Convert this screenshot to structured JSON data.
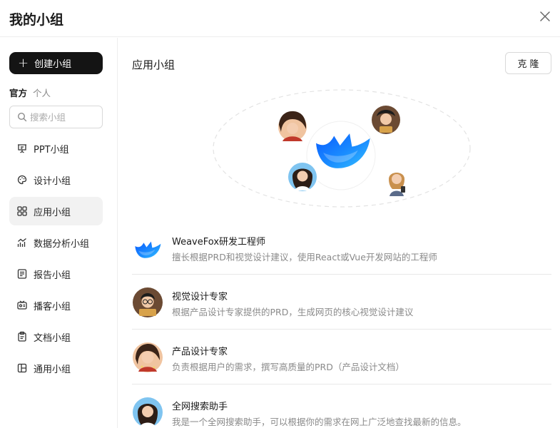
{
  "header": {
    "title": "我的小组"
  },
  "sidebar": {
    "create_label": "创建小组",
    "scope": {
      "official": "官方",
      "personal": "个人"
    },
    "search_placeholder": "搜索小组",
    "items": [
      {
        "label": "PPT小组",
        "icon": "presentation-icon"
      },
      {
        "label": "设计小组",
        "icon": "palette-icon"
      },
      {
        "label": "应用小组",
        "icon": "apps-grid-icon",
        "active": true
      },
      {
        "label": "数据分析小组",
        "icon": "chart-icon"
      },
      {
        "label": "报告小组",
        "icon": "report-icon"
      },
      {
        "label": "播客小组",
        "icon": "podcast-icon"
      },
      {
        "label": "文档小组",
        "icon": "document-icon"
      },
      {
        "label": "通用小组",
        "icon": "layout-icon"
      }
    ]
  },
  "main": {
    "title": "应用小组",
    "clone_label": "克隆",
    "agents": [
      {
        "name": "WeaveFox研发工程师",
        "desc": "擅长根据PRD和视觉设计建议，使用React或Vue开发网站的工程师",
        "avatar": "weavefox-logo"
      },
      {
        "name": "视觉设计专家",
        "desc": "根据产品设计专家提供的PRD，生成网页的核心视觉设计建议",
        "avatar": "designer-avatar"
      },
      {
        "name": "产品设计专家",
        "desc": "负责根据用户的需求，撰写高质量的PRD（产品设计文档）",
        "avatar": "product-avatar"
      },
      {
        "name": "全网搜索助手",
        "desc": "我是一个全网搜索助手，可以根据你的需求在网上广泛地查找最新的信息。",
        "avatar": "search-avatar"
      }
    ]
  },
  "colors": {
    "primary_dark": "#141414",
    "brand_blue": "#1677ff",
    "active_bg": "#f2f2f2"
  }
}
